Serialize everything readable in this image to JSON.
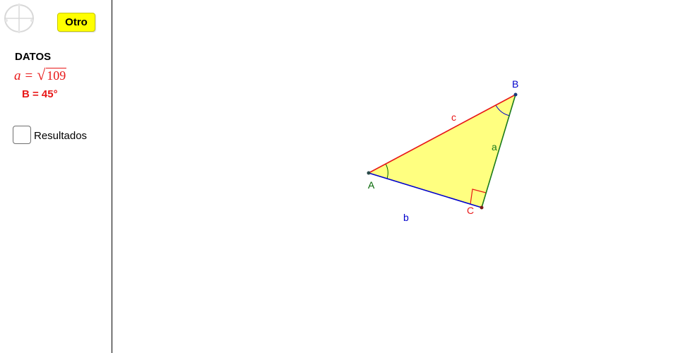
{
  "sidebar": {
    "button_label": "Otro",
    "datos_heading": "DATOS",
    "formula": {
      "var": "a",
      "equals": "=",
      "radical": "√",
      "radicand": "109"
    },
    "given_angle": "B = 45°",
    "checkbox_label": "Resultados",
    "checkbox_checked": false
  },
  "figure": {
    "vertices": [
      {
        "id": "A",
        "label": "A",
        "color": "#006400"
      },
      {
        "id": "B",
        "label": "B",
        "color": "#0000cc"
      },
      {
        "id": "C",
        "label": "C",
        "color": "#e81818"
      }
    ],
    "sides": [
      {
        "id": "a",
        "label": "a",
        "from": "B",
        "to": "C",
        "color": "#1a7a1a"
      },
      {
        "id": "b",
        "label": "b",
        "from": "A",
        "to": "C",
        "color": "#0000cc"
      },
      {
        "id": "c",
        "label": "c",
        "from": "A",
        "to": "B",
        "color": "#e81818"
      }
    ],
    "right_angle_at": "C",
    "marked_angles": [
      "A",
      "B"
    ],
    "fill_color": "#ffff80"
  }
}
